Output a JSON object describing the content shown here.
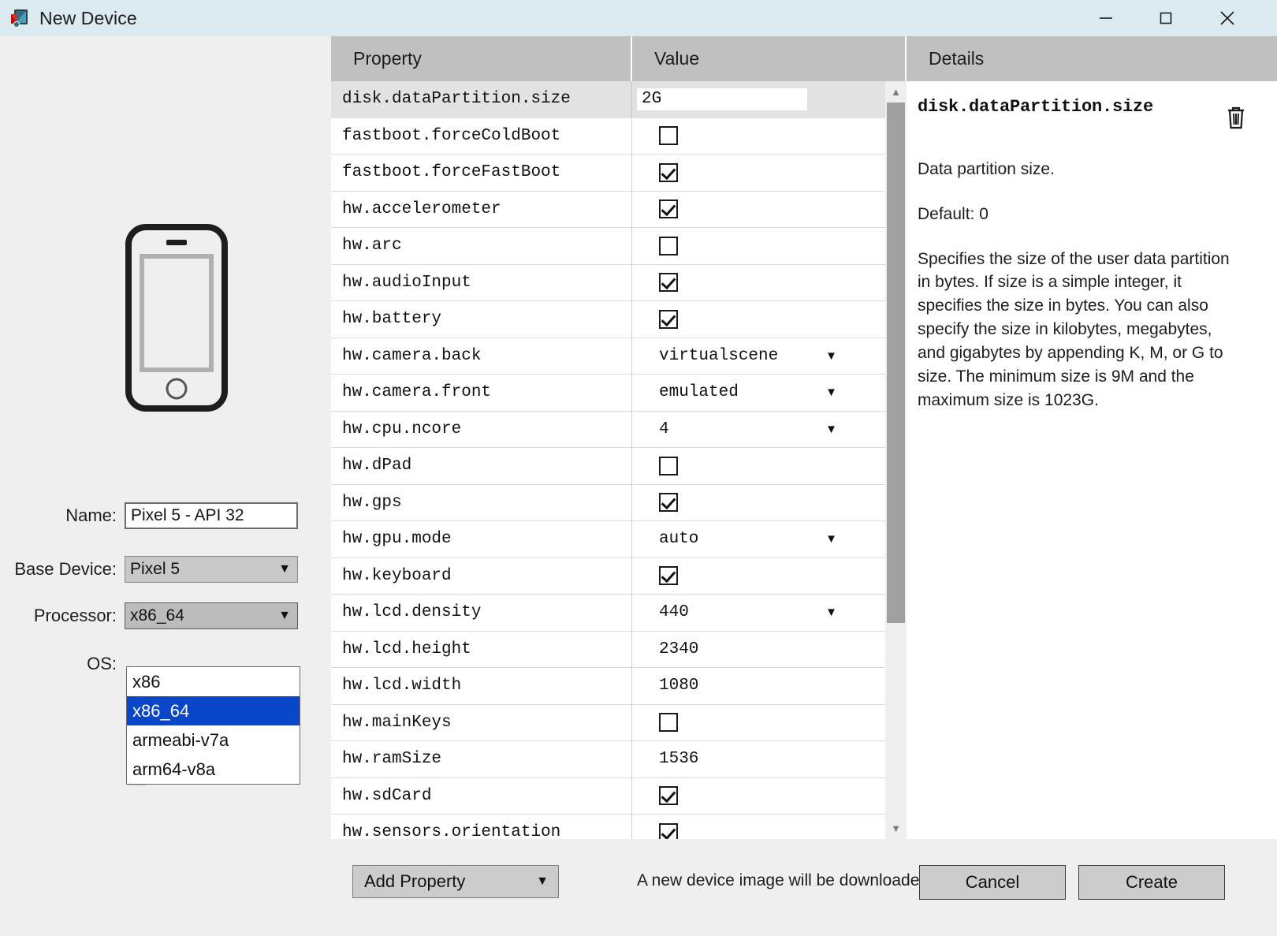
{
  "window": {
    "title": "New Device",
    "icon": "android-studio-device-icon",
    "controls": {
      "minimize": "minimize-icon",
      "maximize": "maximize-icon",
      "close": "close-icon"
    }
  },
  "left_panel": {
    "device_preview_icon": "phone-illustration",
    "fields": {
      "name_label": "Name:",
      "name_value": "Pixel 5 - API 32",
      "base_device_label": "Base Device:",
      "base_device_value": "Pixel 5",
      "processor_label": "Processor:",
      "processor_value": "x86_64",
      "os_label": "OS:"
    },
    "processor_dropdown": {
      "open": true,
      "selected": "x86_64",
      "options": [
        "x86",
        "x86_64",
        "armeabi-v7a",
        "arm64-v8a"
      ]
    }
  },
  "table": {
    "headers": {
      "property": "Property",
      "value": "Value",
      "details": "Details"
    },
    "selected_row": "disk.dataPartition.size",
    "rows": [
      {
        "property": "disk.dataPartition.size",
        "type": "text",
        "value": "2G",
        "selected": true
      },
      {
        "property": "fastboot.forceColdBoot",
        "type": "checkbox",
        "value": false
      },
      {
        "property": "fastboot.forceFastBoot",
        "type": "checkbox",
        "value": true
      },
      {
        "property": "hw.accelerometer",
        "type": "checkbox",
        "value": true
      },
      {
        "property": "hw.arc",
        "type": "checkbox",
        "value": false
      },
      {
        "property": "hw.audioInput",
        "type": "checkbox",
        "value": true
      },
      {
        "property": "hw.battery",
        "type": "checkbox",
        "value": true
      },
      {
        "property": "hw.camera.back",
        "type": "combo",
        "value": "virtualscene"
      },
      {
        "property": "hw.camera.front",
        "type": "combo",
        "value": "emulated"
      },
      {
        "property": "hw.cpu.ncore",
        "type": "combo",
        "value": "4"
      },
      {
        "property": "hw.dPad",
        "type": "checkbox",
        "value": false
      },
      {
        "property": "hw.gps",
        "type": "checkbox",
        "value": true
      },
      {
        "property": "hw.gpu.mode",
        "type": "combo",
        "value": "auto"
      },
      {
        "property": "hw.keyboard",
        "type": "checkbox",
        "value": true
      },
      {
        "property": "hw.lcd.density",
        "type": "combo",
        "value": "440"
      },
      {
        "property": "hw.lcd.height",
        "type": "plain",
        "value": "2340"
      },
      {
        "property": "hw.lcd.width",
        "type": "plain",
        "value": "1080"
      },
      {
        "property": "hw.mainKeys",
        "type": "checkbox",
        "value": false
      },
      {
        "property": "hw.ramSize",
        "type": "plain",
        "value": "1536"
      },
      {
        "property": "hw.sdCard",
        "type": "checkbox",
        "value": true
      },
      {
        "property": "hw.sensors.orientation",
        "type": "checkbox",
        "value": true
      }
    ],
    "scrollbar": {
      "up_arrow": "chevron-up-icon",
      "down_arrow": "chevron-down-icon"
    }
  },
  "details": {
    "title": "disk.dataPartition.size",
    "delete_icon": "trash-icon",
    "summary": "Data partition size.",
    "default_line": "Default: 0",
    "description": "Specifies the size of the user data partition in bytes. If size is a simple integer, it specifies the size in bytes. You can also specify the size in kilobytes, megabytes, and gigabytes by appending K, M, or G to size. The minimum size is 9M and the maximum size is 1023G."
  },
  "footer": {
    "add_property_label": "Add Property",
    "download_note": "A new device image will be downloaded.",
    "cancel_label": "Cancel",
    "create_label": "Create"
  },
  "colors": {
    "titlebar": "#dbeaf0",
    "panel": "#efefef",
    "header": "#c0c0c0",
    "selection": "#0a46c8",
    "row_selected": "#e2e2e2"
  }
}
